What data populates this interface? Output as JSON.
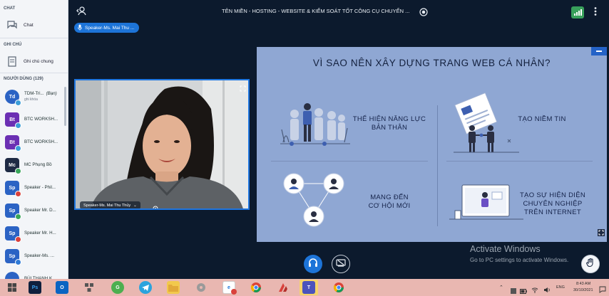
{
  "sidebar": {
    "chat_section": "CHAT",
    "chat_label": "Chat",
    "notes_section": "GHI CHÚ",
    "notes_label": "Ghi chú chung",
    "users_section": "NGƯỜI DÙNG (129)",
    "users": [
      {
        "initials": "Td",
        "name": "TDM-Tri...",
        "tag": "(Bạn)",
        "sub": "ghi khóa",
        "color": "#2b63c4",
        "round": true,
        "status": "#3b9dd8"
      },
      {
        "initials": "Bt",
        "name": "BTC WORKSH...",
        "color": "#6b2fb3",
        "round": false,
        "status": "#3b9dd8"
      },
      {
        "initials": "Bt",
        "name": "BTC WORKSH...",
        "color": "#6b2fb3",
        "round": false,
        "status": "#3b9dd8"
      },
      {
        "initials": "Mc",
        "name": "MC Phụng Bồ",
        "color": "#1e2a44",
        "round": false,
        "status": "#3aa65a"
      },
      {
        "initials": "Sp",
        "name": "Speaker - Phil...",
        "color": "#2b63c4",
        "round": false,
        "status": "#d9413b"
      },
      {
        "initials": "Sp",
        "name": "Speaker Mr. D...",
        "color": "#2b63c4",
        "round": false,
        "status": "#3aa65a"
      },
      {
        "initials": "Sp",
        "name": "Speaker Mr. H...",
        "color": "#2b63c4",
        "round": false,
        "status": "#d9413b"
      },
      {
        "initials": "Sp",
        "name": "Speaker-Ms. ...",
        "color": "#2b63c4",
        "round": false,
        "status": "#2f7ad6"
      },
      {
        "initials": "",
        "name": "BÙI THANH K...",
        "color": "#2b63c4",
        "round": true,
        "status": "#3b9dd8"
      }
    ]
  },
  "topbar": {
    "title": "TÊN MIỀN - HOSTING - WEBSITE & KIỂM SOÁT TỐT CÔNG CỤ CHUYỂN ...",
    "speaker_pill": "Speaker-Ms. Mai Thu ..."
  },
  "webcam": {
    "name_label": "Speaker-Ms. Mai Thu Thủy"
  },
  "slide": {
    "title": "VÌ SAO NÊN XÂY DỰNG TRANG WEB CÁ NHÂN?",
    "items": [
      {
        "line1": "THỂ HIỆN NĂNG LỰC",
        "line2": "BẢN THÂN"
      },
      {
        "line1": "TẠO NIỀM TIN"
      },
      {
        "line1": "MANG ĐẾN",
        "line2": "CƠ HỘI MỚI"
      },
      {
        "line1": "TẠO SỰ HIỆN DIỆN",
        "line2": "CHUYÊN NGHIỆP",
        "line3": "TRÊN INTERNET"
      }
    ]
  },
  "watermark": {
    "line1": "Activate Windows",
    "line2": "Go to PC settings to activate Windows."
  },
  "taskbar": {
    "lang": "ENG",
    "time": "8:43 AM",
    "date": "30/10/2021"
  },
  "colors": {
    "primary_blue": "#1d74d8",
    "slide_bg": "#8fa7d3",
    "app_bg": "#0c1a2d",
    "taskbar_bg": "#e9b7b1"
  }
}
